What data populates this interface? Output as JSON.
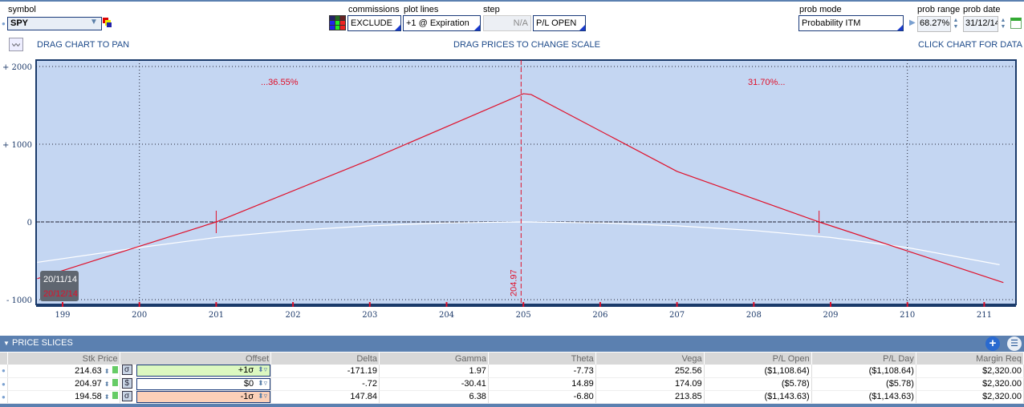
{
  "toolbar": {
    "symbol_label": "symbol",
    "symbol_value": "SPY",
    "commissions_label": "commissions",
    "commissions_value": "EXCLUDE",
    "plot_lines_label": "plot lines",
    "plot_lines_value": "+1 @ Expiration",
    "step_label": "step",
    "step_value": "N/A",
    "step_mode": "P/L OPEN",
    "prob_mode_label": "prob mode",
    "prob_mode_value": "Probability ITM",
    "prob_range_label": "prob range",
    "prob_range_value": "68.27%",
    "prob_date_label": "prob date",
    "prob_date_value": "31/12/14"
  },
  "hints": {
    "pan": "DRAG CHART TO PAN",
    "scale": "DRAG PRICES TO CHANGE SCALE",
    "data": "CLICK CHART FOR DATA"
  },
  "chart": {
    "y_ticks": [
      "+ 2000",
      "+ 1000",
      "0",
      "- 1000"
    ],
    "y_values": [
      2000,
      1000,
      0,
      -1000
    ],
    "x_ticks": [
      "199",
      "200",
      "201",
      "202",
      "203",
      "204",
      "205",
      "206",
      "207",
      "208",
      "209",
      "210",
      "211"
    ],
    "left_prob": "...36.55%",
    "right_prob": "31.70%...",
    "current_price": "204.97",
    "legend_date_1": "20/11/14",
    "legend_date_2": "20/12/14",
    "expiration_series": {
      "x": [
        198.67,
        201,
        203,
        205,
        205.1,
        207,
        208.85,
        211.25
      ],
      "y": [
        -730,
        0,
        800,
        1650,
        1640,
        650,
        0,
        -780
      ]
    },
    "today_series": {
      "x": [
        198.67,
        200,
        201,
        202,
        203,
        204,
        205,
        206,
        207,
        208,
        209,
        210,
        211.2
      ],
      "y": [
        -520,
        -330,
        -200,
        -110,
        -50,
        -12,
        0,
        -12,
        -50,
        -110,
        -200,
        -330,
        -550
      ]
    },
    "colors": {
      "expiration": "#e0102a",
      "today": "#ffffff",
      "bg": "#c4d6f2"
    }
  },
  "slices": {
    "title": "PRICE SLICES",
    "columns": [
      "Stk Price",
      "Offset",
      "Delta",
      "Gamma",
      "Theta",
      "Vega",
      "P/L Open",
      "P/L Day",
      "Margin Req"
    ],
    "rows": [
      {
        "price": "214.63",
        "mode": "σ",
        "offset": "+1σ",
        "delta": "-171.19",
        "gamma": "1.97",
        "theta": "-7.73",
        "vega": "252.56",
        "pl_open": "($1,108.64)",
        "pl_day": "($1,108.64)",
        "margin": "$2,320.00",
        "color": "#dcf8c0"
      },
      {
        "price": "204.97",
        "mode": "$",
        "offset": "$0",
        "delta": "-.72",
        "gamma": "-30.41",
        "theta": "14.89",
        "vega": "174.09",
        "pl_open": "($5.78)",
        "pl_day": "($5.78)",
        "margin": "$2,320.00",
        "color": "#ffffff"
      },
      {
        "price": "194.58",
        "mode": "σ",
        "offset": "-1σ",
        "delta": "147.84",
        "gamma": "6.38",
        "theta": "-6.80",
        "vega": "213.85",
        "pl_open": "($1,143.63)",
        "pl_day": "($1,143.63)",
        "margin": "$2,320.00",
        "color": "#fcd0b8"
      }
    ]
  }
}
